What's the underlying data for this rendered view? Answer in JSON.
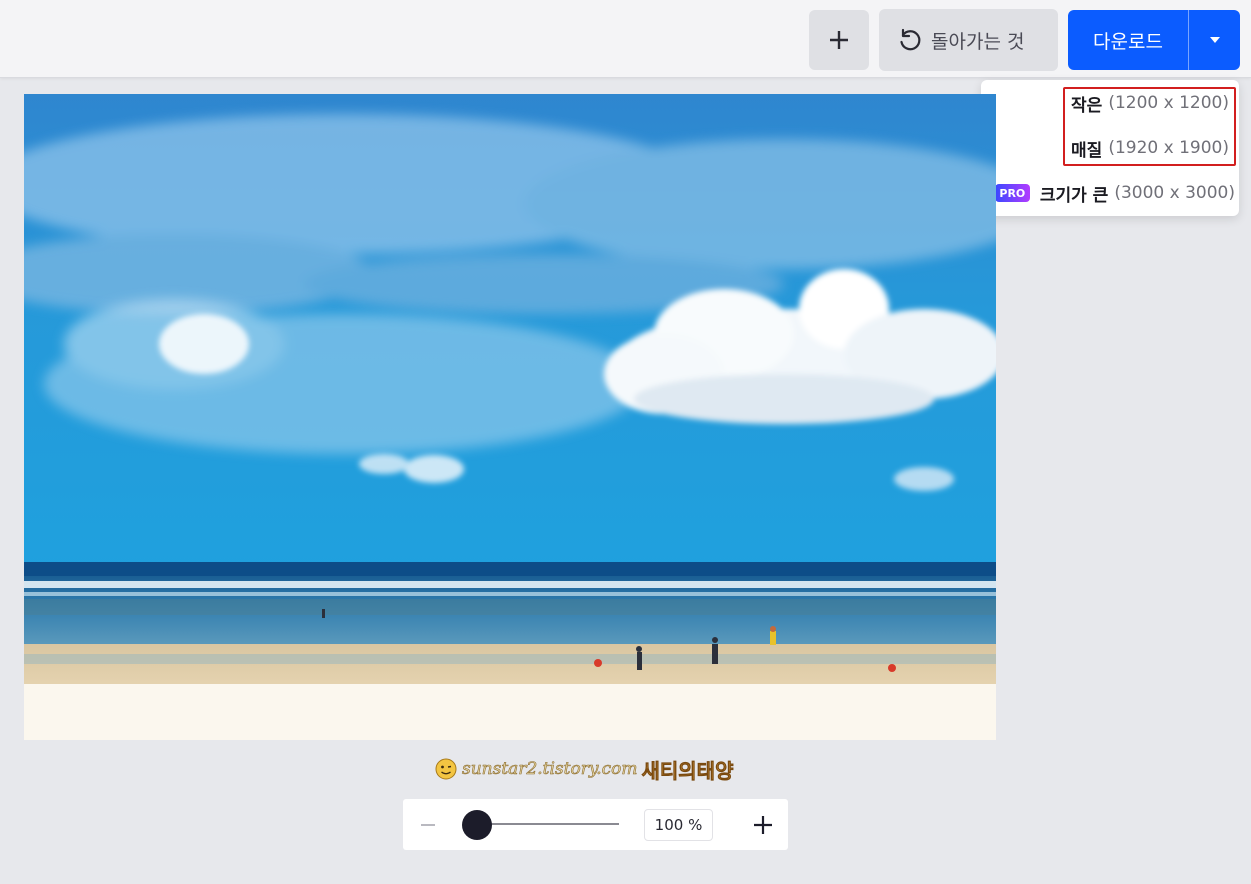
{
  "toolbar": {
    "add_icon": "plus-icon",
    "undo_label": "돌아가는 것",
    "undo_icon": "undo-icon",
    "download_label": "다운로드",
    "download_caret_icon": "caret-down-icon"
  },
  "download_menu": {
    "items": [
      {
        "name": "작은",
        "size": "(1200 x 1200)"
      },
      {
        "name": "매질",
        "size": "(1920 x 1900)"
      },
      {
        "badge": "PRO",
        "name": "크기가 큰",
        "size": "(3000 x 3000)"
      }
    ]
  },
  "watermark": {
    "url": "sunstar2.tistory.com",
    "name": "새티의태양"
  },
  "zoom": {
    "value_label": "100 %",
    "level": 0.0
  },
  "colors": {
    "accent": "#0b5cff",
    "highlight": "#d21f1f",
    "background": "#e7e8ec"
  }
}
